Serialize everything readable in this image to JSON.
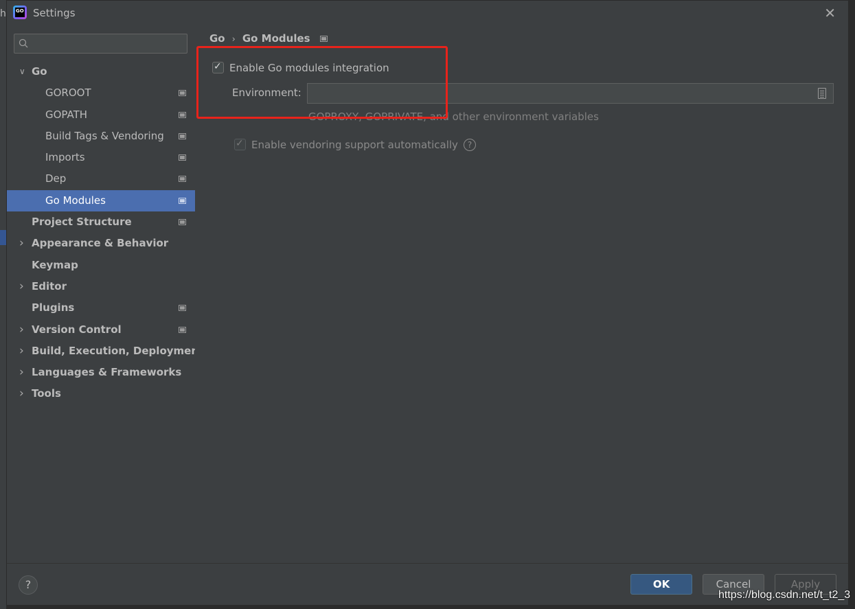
{
  "background": {
    "edge_char": "h"
  },
  "window": {
    "title": "Settings",
    "icon_text": "GO"
  },
  "search": {
    "placeholder": "",
    "value": ""
  },
  "sidebar": {
    "items": [
      {
        "label": "Go",
        "level": "top",
        "arrow": "v",
        "project": false
      },
      {
        "label": "GOROOT",
        "level": "child",
        "project": true
      },
      {
        "label": "GOPATH",
        "level": "child",
        "project": true
      },
      {
        "label": "Build Tags & Vendoring",
        "level": "child",
        "project": true
      },
      {
        "label": "Imports",
        "level": "child",
        "project": true
      },
      {
        "label": "Dep",
        "level": "child",
        "project": true
      },
      {
        "label": "Go Modules",
        "level": "child",
        "project": true,
        "selected": true
      },
      {
        "label": "Project Structure",
        "level": "top",
        "project": true
      },
      {
        "label": "Appearance & Behavior",
        "level": "top",
        "arrow": ">"
      },
      {
        "label": "Keymap",
        "level": "top"
      },
      {
        "label": "Editor",
        "level": "top",
        "arrow": ">"
      },
      {
        "label": "Plugins",
        "level": "top",
        "project": true
      },
      {
        "label": "Version Control",
        "level": "top",
        "arrow": ">",
        "project": true
      },
      {
        "label": "Build, Execution, Deployment",
        "level": "top",
        "arrow": ">"
      },
      {
        "label": "Languages & Frameworks",
        "level": "top",
        "arrow": ">"
      },
      {
        "label": "Tools",
        "level": "top",
        "arrow": ">"
      }
    ]
  },
  "main": {
    "breadcrumb": {
      "parent": "Go",
      "separator": "›",
      "current": "Go Modules"
    },
    "enable_modules": {
      "label": "Enable Go modules integration",
      "checked": true
    },
    "environment": {
      "label": "Environment:",
      "value": "",
      "hint": "GOPROXY, GOPRIVATE, and other environment variables"
    },
    "vendoring": {
      "label": "Enable vendoring support automatically",
      "checked": true,
      "disabled": true,
      "help": "?"
    }
  },
  "footer": {
    "help": "?",
    "ok_label": "OK",
    "cancel_label": "Cancel",
    "apply_label": "Apply"
  },
  "watermark": "https://blog.csdn.net/t_t2_3",
  "colors": {
    "selected_bg": "#4b6eaf",
    "ok_button": "#365880",
    "annotation_red": "#e8231b"
  }
}
